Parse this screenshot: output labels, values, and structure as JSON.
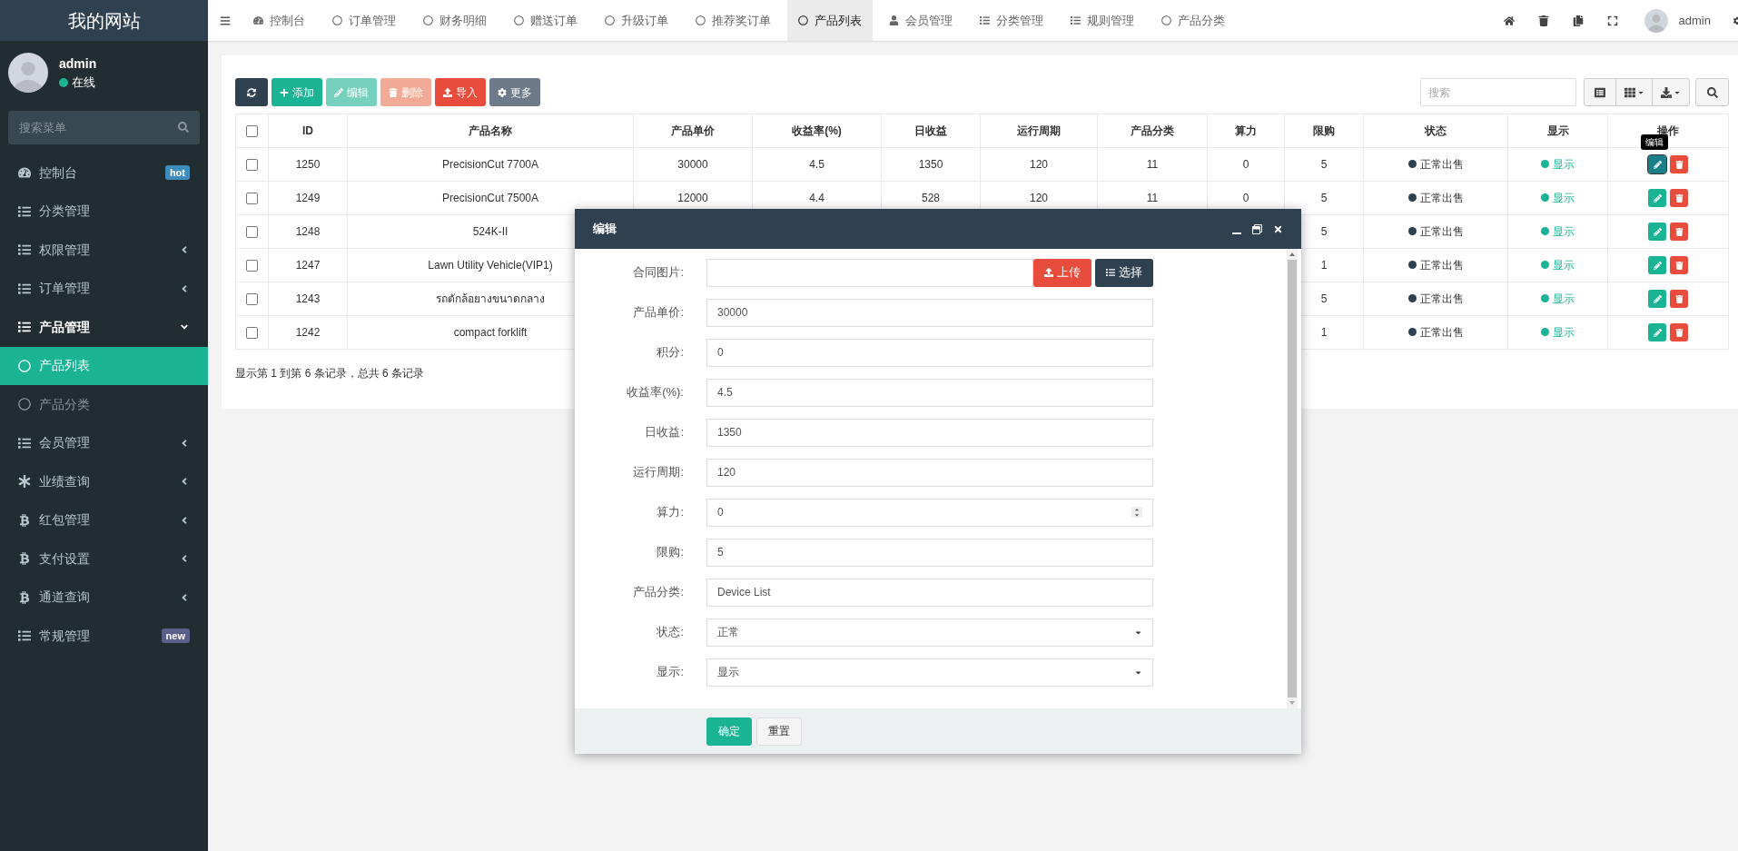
{
  "sidebar": {
    "brand": "我的网站",
    "user": {
      "name": "admin",
      "status": "在线"
    },
    "search": {
      "placeholder": "搜索菜单"
    },
    "items": [
      {
        "kind": "link",
        "label": "控制台",
        "badge": {
          "text": "hot",
          "color": "#3c8dbc"
        },
        "selected": false
      },
      {
        "kind": "link",
        "label": "分类管理",
        "selected": false
      },
      {
        "kind": "group",
        "label": "权限管理",
        "selected": false,
        "expanded": false
      },
      {
        "kind": "group",
        "label": "订单管理",
        "selected": false,
        "expanded": false
      },
      {
        "kind": "group",
        "label": "产品管理",
        "selected": false,
        "expanded": true,
        "children": [
          {
            "label": "产品列表",
            "selected": true
          },
          {
            "label": "产品分类",
            "selected": false
          }
        ]
      },
      {
        "kind": "group",
        "label": "会员管理",
        "selected": false,
        "expanded": false
      },
      {
        "kind": "group",
        "label": "业绩查询",
        "selected": false,
        "expanded": false
      },
      {
        "kind": "group",
        "label": "红包管理",
        "selected": false,
        "expanded": false
      },
      {
        "kind": "group",
        "label": "支付设置",
        "selected": false,
        "expanded": false
      },
      {
        "kind": "group",
        "label": "通道查询",
        "selected": false,
        "expanded": false
      },
      {
        "kind": "link",
        "label": "常规管理",
        "badge": {
          "text": "new",
          "color": "#5a5f8a"
        },
        "selected": false
      }
    ]
  },
  "topbar": {
    "tabs": [
      {
        "label": "控制台",
        "selected": false
      },
      {
        "label": "订单管理",
        "selected": false
      },
      {
        "label": "财务明细",
        "selected": false
      },
      {
        "label": "赠送订单",
        "selected": false
      },
      {
        "label": "升级订单",
        "selected": false
      },
      {
        "label": "推荐奖订单",
        "selected": false
      },
      {
        "label": "产品列表",
        "selected": true
      },
      {
        "label": "会员管理",
        "selected": false
      },
      {
        "label": "分类管理",
        "selected": false
      },
      {
        "label": "规则管理",
        "selected": false
      },
      {
        "label": "产品分类",
        "selected": false
      }
    ],
    "user": "admin"
  },
  "toolbar": {
    "buttons": [
      {
        "kind": "refresh",
        "disabled": false
      },
      {
        "kind": "add",
        "label": "添加",
        "disabled": false
      },
      {
        "kind": "edit",
        "label": "编辑",
        "disabled": true
      },
      {
        "kind": "delete",
        "label": "删除",
        "disabled": true
      },
      {
        "kind": "import",
        "label": "导入",
        "disabled": false
      },
      {
        "kind": "more",
        "label": "更多",
        "disabled": false
      }
    ],
    "search": {
      "placeholder": "搜索"
    }
  },
  "table": {
    "header_checked": false,
    "columns": [
      "ID",
      "产品名称",
      "产品单价",
      "收益率(%)",
      "日收益",
      "运行周期",
      "产品分类",
      "算力",
      "限购",
      "状态",
      "显示",
      "操作"
    ],
    "rows": [
      {
        "checked": false,
        "cells": [
          "1250",
          "PrecisionCut 7700A",
          "30000",
          "4.5",
          "1350",
          "120",
          "11",
          "0",
          "5"
        ],
        "status": {
          "text": "正常出售",
          "color": "#2f4050"
        },
        "display": {
          "text": "显示",
          "color": "#1ab394"
        },
        "edit_hovered": true
      },
      {
        "checked": false,
        "cells": [
          "1249",
          "PrecisionCut 7500A",
          "12000",
          "4.4",
          "528",
          "120",
          "11",
          "0",
          "5"
        ],
        "status": {
          "text": "正常出售",
          "color": "#2f4050"
        },
        "display": {
          "text": "显示",
          "color": "#1ab394"
        },
        "edit_hovered": false
      },
      {
        "checked": false,
        "cells": [
          "1248",
          "524K-II",
          null,
          null,
          null,
          null,
          null,
          null,
          "5"
        ],
        "status": {
          "text": "正常出售",
          "color": "#2f4050"
        },
        "display": {
          "text": "显示",
          "color": "#1ab394"
        },
        "edit_hovered": false
      },
      {
        "checked": false,
        "cells": [
          "1247",
          "Lawn Utility Vehicle(VIP1)",
          null,
          null,
          null,
          null,
          null,
          null,
          "1"
        ],
        "status": {
          "text": "正常出售",
          "color": "#2f4050"
        },
        "display": {
          "text": "显示",
          "color": "#1ab394"
        },
        "edit_hovered": false
      },
      {
        "checked": false,
        "cells": [
          "1243",
          "รถตักล้อยางขนาดกลาง",
          null,
          null,
          null,
          null,
          null,
          null,
          "5"
        ],
        "status": {
          "text": "正常出售",
          "color": "#2f4050"
        },
        "display": {
          "text": "显示",
          "color": "#1ab394"
        },
        "edit_hovered": false
      },
      {
        "checked": false,
        "cells": [
          "1242",
          "compact forklift",
          null,
          null,
          null,
          null,
          null,
          null,
          "1"
        ],
        "status": {
          "text": "正常出售",
          "color": "#2f4050"
        },
        "display": {
          "text": "显示",
          "color": "#1ab394"
        },
        "edit_hovered": false
      }
    ],
    "tooltip": "编辑",
    "footer": "显示第 1 到第 6 条记录，总共 6 条记录"
  },
  "dialog": {
    "title": "编辑",
    "fields": [
      {
        "kind": "upload",
        "label": "合同图片:",
        "buttons": [
          "上传",
          "选择"
        ]
      },
      {
        "kind": "text",
        "label": "产品单价:",
        "value": "30000"
      },
      {
        "kind": "text",
        "label": "积分:",
        "value": "0"
      },
      {
        "kind": "text",
        "label": "收益率(%):",
        "value": "4.5"
      },
      {
        "kind": "text",
        "label": "日收益:",
        "value": "1350"
      },
      {
        "kind": "text",
        "label": "运行周期:",
        "value": "120"
      },
      {
        "kind": "number",
        "label": "算力:",
        "value": "0"
      },
      {
        "kind": "text",
        "label": "限购:",
        "value": "5"
      },
      {
        "kind": "text",
        "label": "产品分类:",
        "value": "Device List"
      },
      {
        "kind": "select",
        "label": "状态:",
        "value": "正常"
      },
      {
        "kind": "select",
        "label": "显示:",
        "value": "显示"
      }
    ],
    "buttons": [
      {
        "kind": "primary",
        "label": "确定"
      },
      {
        "kind": "default",
        "label": "重置"
      }
    ]
  }
}
